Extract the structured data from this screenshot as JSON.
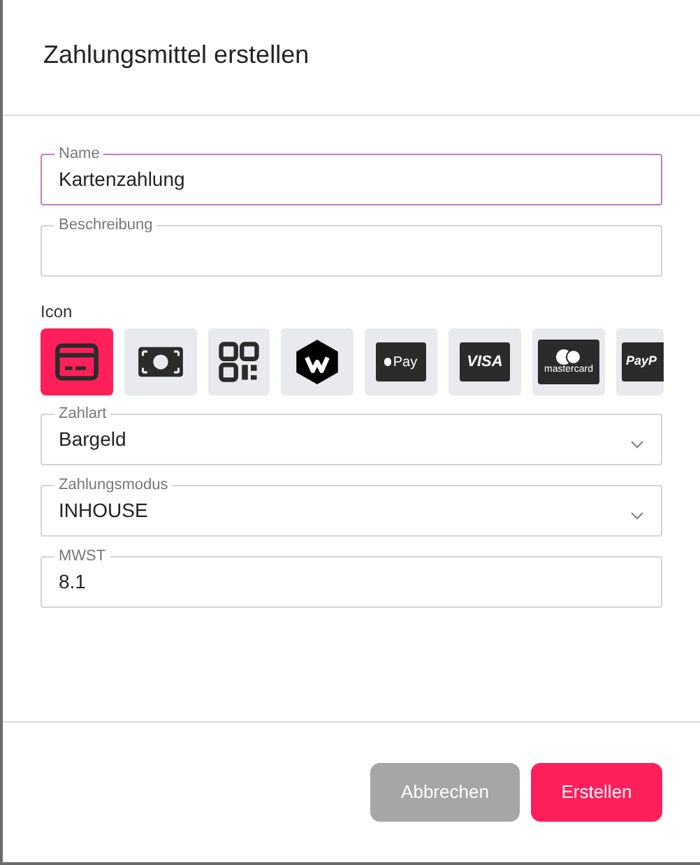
{
  "dialog": {
    "title": "Zahlungsmittel erstellen"
  },
  "fields_top": [
    {
      "label": "Name",
      "value": "Kartenzahlung",
      "focused": true
    },
    {
      "label": "Beschreibung",
      "focused": false
    }
  ],
  "icon_picker": {
    "label": "Icon",
    "icons": [
      {
        "kind": "card",
        "selected": true
      },
      {
        "kind": "cash",
        "selected": false
      },
      {
        "kind": "qr",
        "selected": false
      },
      {
        "kind": "twint",
        "selected": false
      },
      {
        "kind": "applepay",
        "text": "Pay",
        "selected": false
      },
      {
        "kind": "visa",
        "text": "VISA",
        "selected": false
      },
      {
        "kind": "mastercard",
        "text": "mastercard",
        "selected": false
      },
      {
        "kind": "paypal",
        "text": "PayP",
        "selected": false
      }
    ]
  },
  "fields_bottom": [
    {
      "label": "Zahlart",
      "value": "Bargeld",
      "kind": "select",
      "focused": false
    },
    {
      "label": "Zahlungsmodus",
      "value": "INHOUSE",
      "kind": "select",
      "focused": false
    },
    {
      "label": "MWST",
      "value": "8.1",
      "kind": "text",
      "focused": false
    }
  ],
  "buttons": [
    {
      "label": "Abbrechen",
      "kind": "secondary"
    },
    {
      "label": "Erstellen",
      "kind": "primary"
    }
  ]
}
